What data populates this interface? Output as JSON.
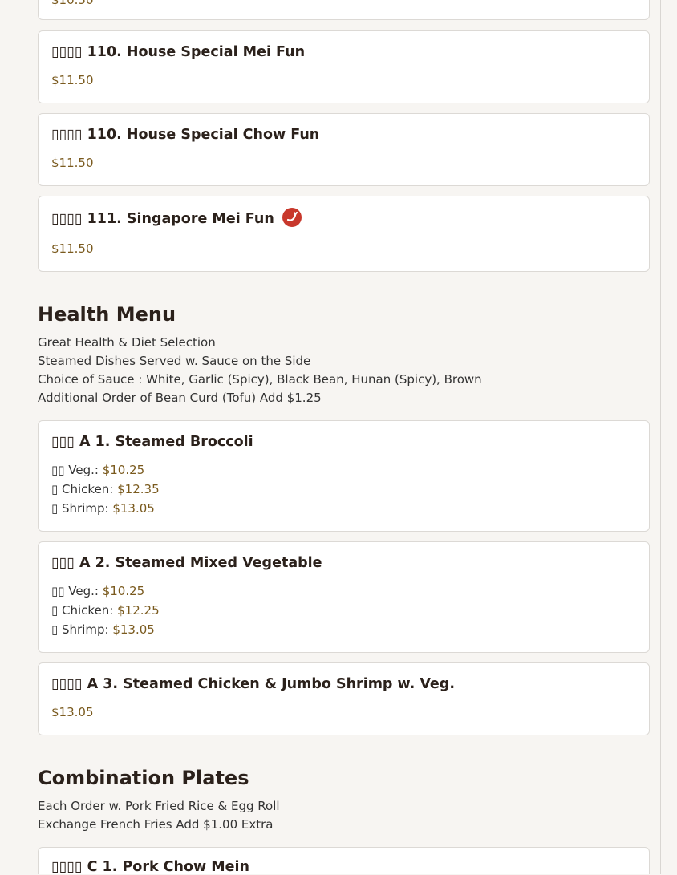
{
  "top_partial_price": "$10.50",
  "items_top": [
    {
      "name": "▯▯▯▯ 110. House Special Mei Fun",
      "price": "$11.50"
    },
    {
      "name": "▯▯▯▯ 110. House Special Chow Fun",
      "price": "$11.50"
    },
    {
      "name": "▯▯▯▯ 111. Singapore Mei Fun",
      "price": "$11.50",
      "spicy": true
    }
  ],
  "health": {
    "title": "Health Menu",
    "desc": [
      "Great Health & Diet Selection",
      "Steamed Dishes Served w. Sauce on the Side",
      "Choice of Sauce : White, Garlic (Spicy), Black Bean, Hunan (Spicy), Brown",
      "Additional Order of Bean Curd (Tofu) Add $1.25"
    ],
    "items": [
      {
        "name": "▯▯▯ A 1. Steamed Broccoli",
        "options": [
          {
            "label": "▯▯ Veg.: ",
            "price": "$10.25"
          },
          {
            "label": "▯ Chicken: ",
            "price": "$12.35"
          },
          {
            "label": "▯ Shrimp: ",
            "price": "$13.05"
          }
        ]
      },
      {
        "name": "▯▯▯ A 2. Steamed Mixed Vegetable",
        "options": [
          {
            "label": "▯▯ Veg.: ",
            "price": "$10.25"
          },
          {
            "label": "▯ Chicken: ",
            "price": "$12.25"
          },
          {
            "label": "▯ Shrimp: ",
            "price": "$13.05"
          }
        ]
      },
      {
        "name": "▯▯▯▯ A 3. Steamed Chicken & Jumbo Shrimp w. Veg.",
        "price": "$13.05"
      }
    ]
  },
  "combo": {
    "title": "Combination Plates",
    "desc": [
      "Each Order w. Pork Fried Rice & Egg Roll",
      "Exchange French Fries Add $1.00 Extra"
    ],
    "items": [
      {
        "name": "▯▯▯▯ C 1. Pork Chow Mein"
      }
    ]
  },
  "icons": {
    "spicy": "chili-pepper-icon"
  },
  "colors": {
    "price": "#7a5a1e",
    "spicy_badge": "#c8382c"
  }
}
